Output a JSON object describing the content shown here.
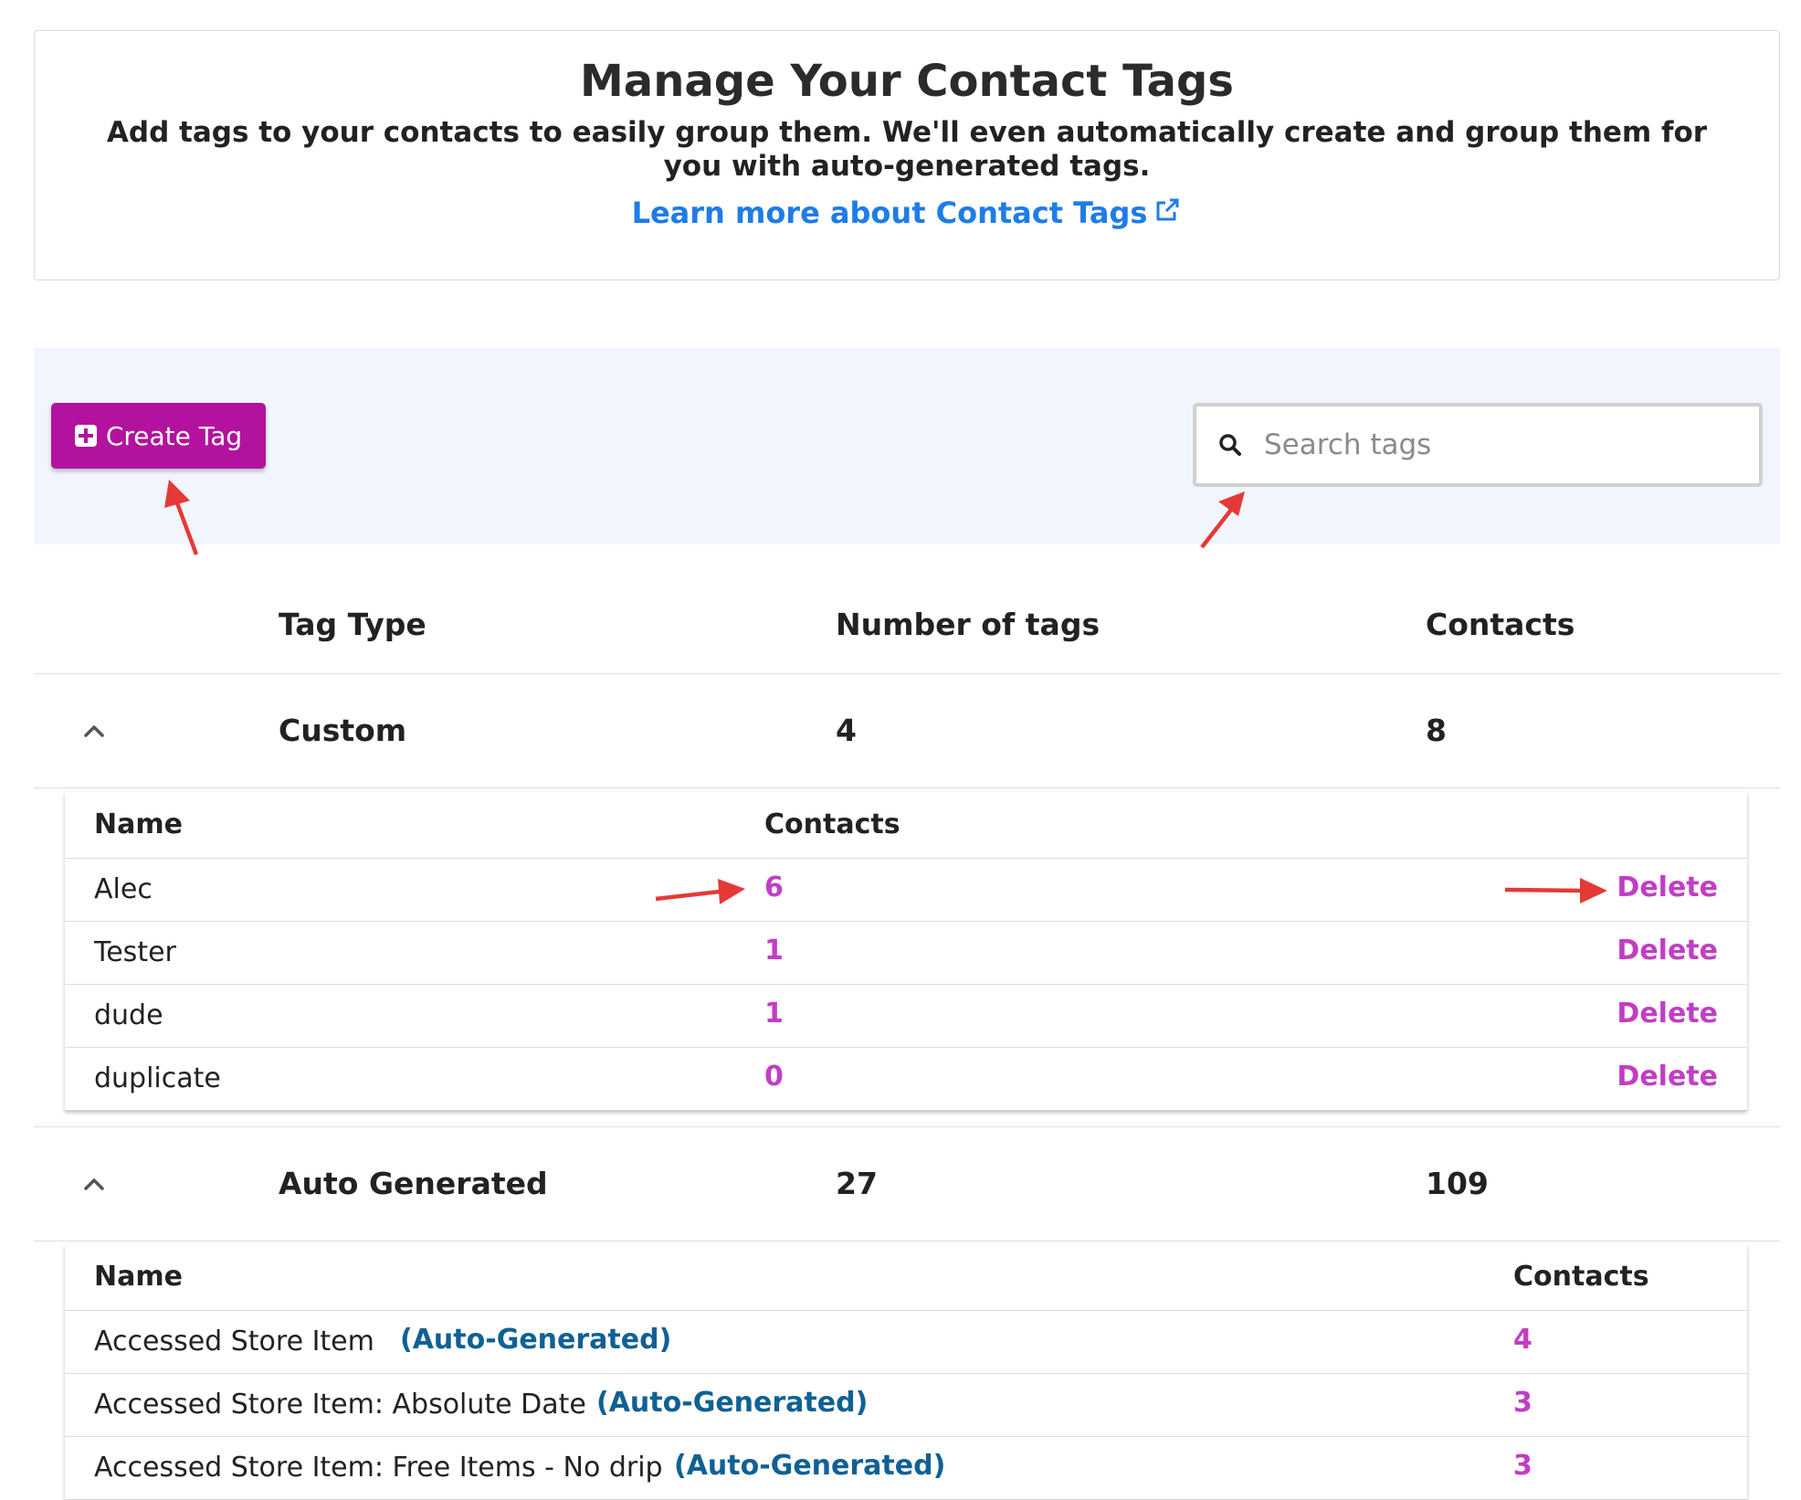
{
  "header": {
    "title": "Manage Your Contact Tags",
    "description": "Add tags to your contacts to easily group them. We'll even automatically create and group them for you with auto-generated tags.",
    "learn_more_label": "Learn more about Contact Tags"
  },
  "toolbar": {
    "create_tag_label": "Create Tag",
    "search_placeholder": "Search tags"
  },
  "table": {
    "headers": {
      "tag_type": "Tag Type",
      "number_of_tags": "Number of tags",
      "contacts": "Contacts"
    },
    "groups": [
      {
        "tag_type": "Custom",
        "number_of_tags": "4",
        "contacts": "8",
        "sub_headers": {
          "name": "Name",
          "contacts": "Contacts"
        },
        "rows": [
          {
            "name": "Alec",
            "contacts": "6",
            "action": "Delete"
          },
          {
            "name": "Tester",
            "contacts": "1",
            "action": "Delete"
          },
          {
            "name": "dude",
            "contacts": "1",
            "action": "Delete"
          },
          {
            "name": "duplicate",
            "contacts": "0",
            "action": "Delete"
          }
        ]
      },
      {
        "tag_type": "Auto Generated",
        "number_of_tags": "27",
        "contacts": "109",
        "sub_headers": {
          "name": "Name",
          "contacts": "Contacts"
        },
        "rows": [
          {
            "name": "Accessed Store Item",
            "badge": "(Auto-Generated)",
            "contacts": "4"
          },
          {
            "name": "Accessed Store Item: Absolute Date",
            "badge": "(Auto-Generated)",
            "contacts": "3"
          },
          {
            "name": "Accessed Store Item: Free Items - No drip",
            "badge": "(Auto-Generated)",
            "contacts": "3"
          }
        ]
      }
    ]
  },
  "colors": {
    "primary": "#b3129e",
    "link": "#1e7ce8",
    "count": "#c13ec4",
    "badge": "#0f6193",
    "annotation_arrow": "#e53935"
  }
}
